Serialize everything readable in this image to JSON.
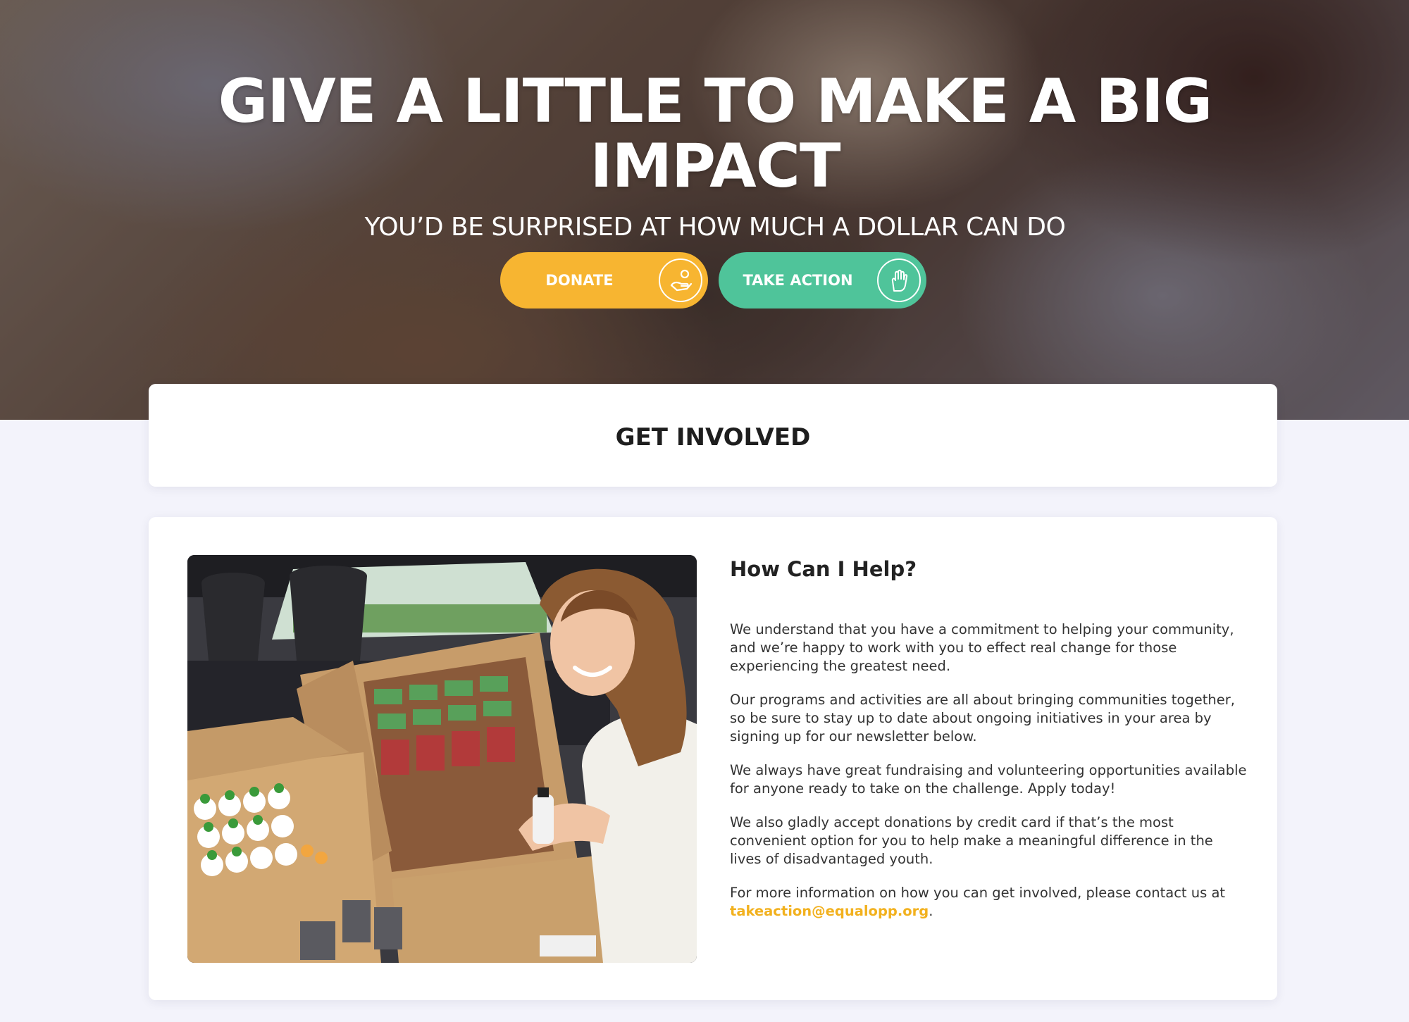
{
  "hero": {
    "title": "GIVE A LITTLE TO MAKE A BIG IMPACT",
    "subtitle": "YOU’D BE SURPRISED AT HOW MUCH A DOLLAR CAN DO",
    "donate_label": "DONATE",
    "take_action_label": "TAKE ACTION"
  },
  "get_involved": {
    "title": "GET INVOLVED"
  },
  "help": {
    "title": "How Can I Help?",
    "para1": "We understand that you have a commitment to helping your community, and we’re happy to work with you to effect real change for those experiencing the greatest need.",
    "para2": "Our programs and activities are all about bringing communities together, so be sure to stay up to date about ongoing initiatives in your area by signing up for our newsletter below.",
    "para3": "We always have great fundraising and volunteering opportunities available for anyone ready to take on the challenge. Apply today!",
    "para4": "We also gladly accept donations by credit card if that’s the most convenient option for you to help make a meaningful difference in the lives of disadvantaged youth.",
    "para5_prefix": "For more information on how you can get involved, please contact us at ",
    "email": "takeaction@equalopp.org",
    "para5_suffix": "."
  },
  "colors": {
    "donate": "#f7b531",
    "take_action": "#4fc49a",
    "link": "#f2b11e",
    "page_bg": "#f3f3fb"
  },
  "icons": [
    "hand-coin-icon",
    "hand-raise-icon"
  ]
}
